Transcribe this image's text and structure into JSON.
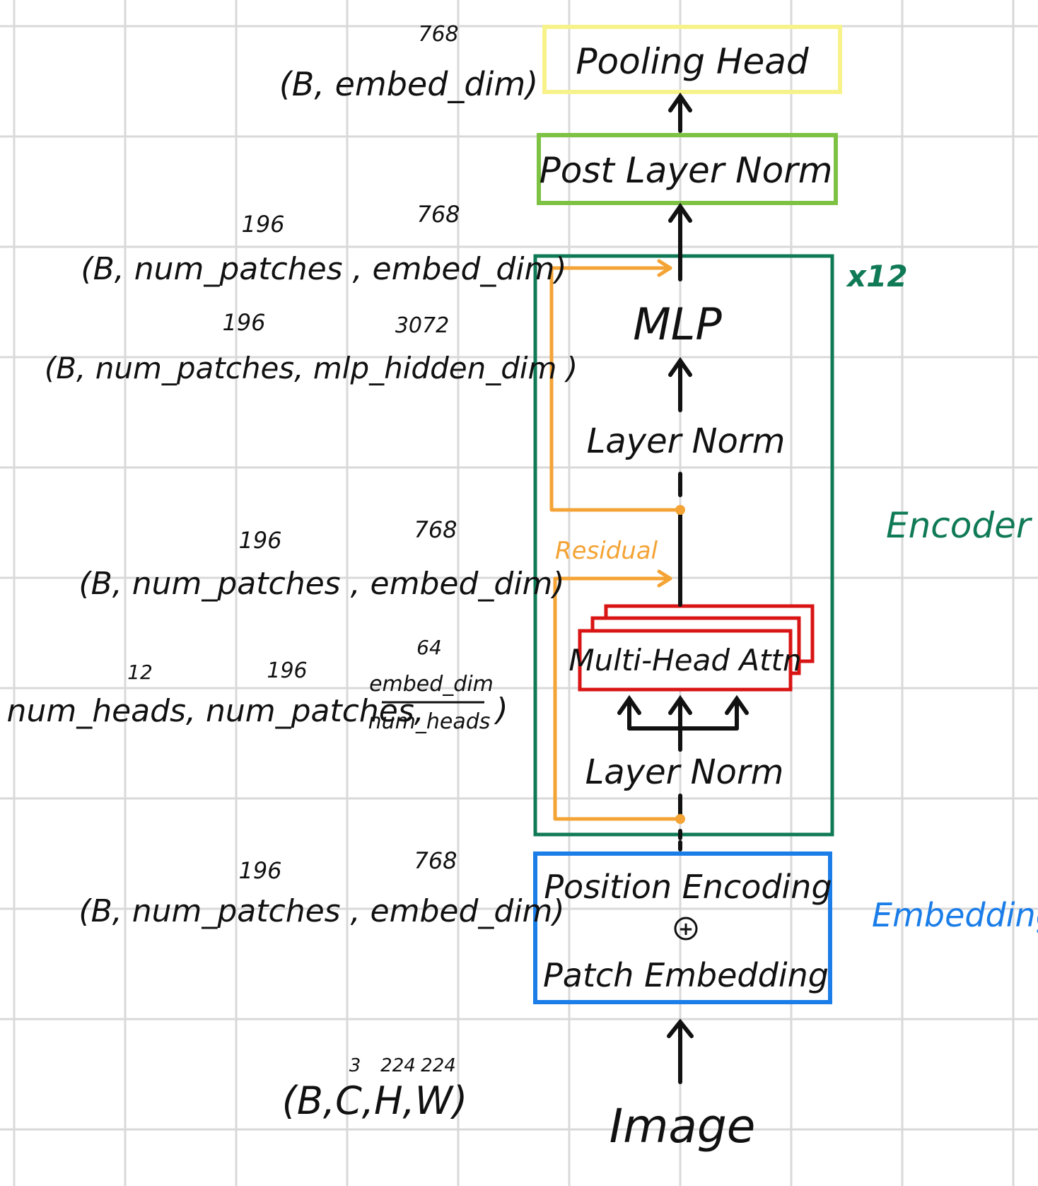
{
  "blocks": {
    "pooling_head": "Pooling Head",
    "post_layer_norm": "Post Layer Norm",
    "mlp": "MLP",
    "layer_norm_top": "Layer Norm",
    "multi_head_attn": "Multi-Head Attn",
    "layer_norm_bottom": "Layer Norm",
    "position_encoding": "Position Encoding",
    "plus": "+",
    "patch_embedding": "Patch Embedding",
    "image": "Image"
  },
  "side_labels": {
    "repeat": "x12",
    "encoder": "Encoder",
    "embedding": "Embedding",
    "residual": "Residual"
  },
  "shapes": {
    "pooling": {
      "text": "(B, embed_dim)",
      "dims": [
        "768"
      ]
    },
    "post_norm_out": {
      "text": "(B, num_patches , embed_dim)",
      "dims": [
        "196",
        "768"
      ]
    },
    "mlp_hidden": {
      "text": "(B, num_patches, mlp_hidden_dim )",
      "dims": [
        "196",
        "3072"
      ]
    },
    "attn_out": {
      "text": "(B, num_patches , embed_dim)",
      "dims": [
        "196",
        "768"
      ]
    },
    "attn_heads": {
      "prefix": "(B, num_heads, num_patches,",
      "numerator": "embed_dim",
      "denominator": "num_heads",
      "suffix": ")",
      "dims": [
        "12",
        "196",
        "64"
      ]
    },
    "embed_out": {
      "text": "(B, num_patches , embed_dim)",
      "dims": [
        "196",
        "768"
      ]
    },
    "image_in": {
      "text": "(B,C,H,W)",
      "dims": [
        "3",
        "224",
        "224"
      ]
    }
  },
  "colors": {
    "pooling_box": "#f7f38a",
    "post_norm_box": "#7dc242",
    "encoder_box": "#0f7a55",
    "attn_box": "#d91414",
    "embedding_box": "#1a7de8",
    "residual": "#f4a335",
    "grid": "#d9d9d9"
  }
}
